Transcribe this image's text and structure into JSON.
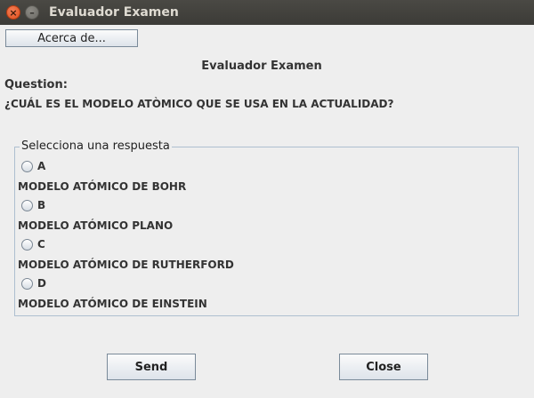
{
  "window": {
    "title": "Evaluador Examen",
    "close_glyph": "×",
    "minimize_glyph": "–"
  },
  "toolbar": {
    "about_label": "Acerca de..."
  },
  "main": {
    "heading": "Evaluador Examen",
    "question_label": "Question:",
    "question_text": "¿CUÁL ES EL MODELO ATÒMICO QUE SE USA EN LA ACTUALIDAD?"
  },
  "answers": {
    "group_title": "Selecciona una respuesta",
    "options": [
      {
        "letter": "A",
        "text": "MODELO ATÓMICO DE BOHR",
        "selected": false
      },
      {
        "letter": "B",
        "text": "MODELO ATÓMICO PLANO",
        "selected": false
      },
      {
        "letter": "C",
        "text": "MODELO ATÓMICO DE RUTHERFORD",
        "selected": false
      },
      {
        "letter": "D",
        "text": "MODELO ATÓMICO DE EINSTEIN",
        "selected": false
      }
    ]
  },
  "actions": {
    "send_label": "Send",
    "close_label": "Close"
  }
}
